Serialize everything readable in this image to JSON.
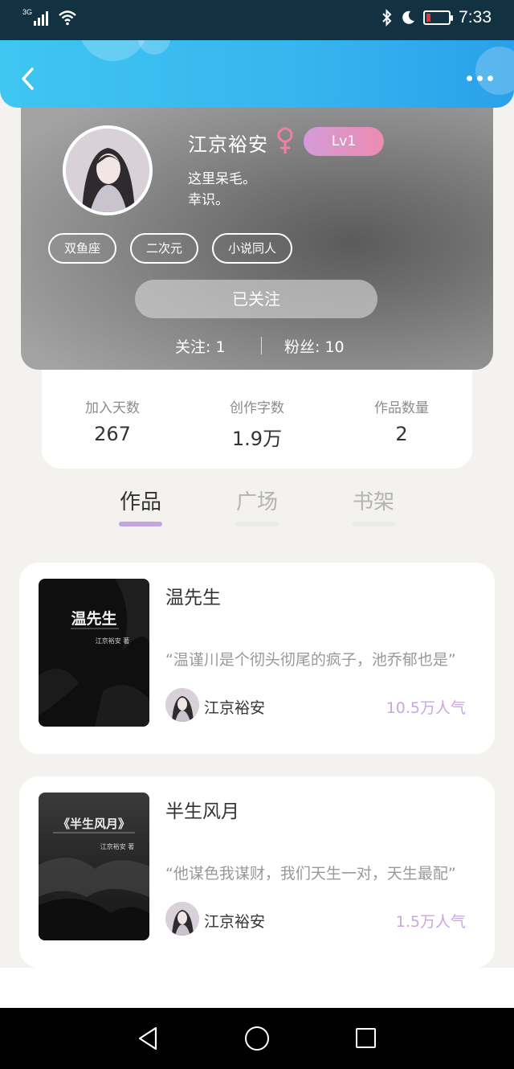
{
  "status_bar": {
    "network": "3G",
    "time": "7:33"
  },
  "header": {
    "back_icon": "chevron-left-icon",
    "more_icon": "more-dots-icon",
    "color_start": "#3fc6f1",
    "color_end": "#2aa0ea"
  },
  "profile": {
    "username": "江京裕安",
    "gender_icon": "female-icon",
    "level": "Lv1",
    "bio_line1": "这里呆毛。",
    "bio_line2": "幸识。",
    "tags": [
      "双鱼座",
      "二次元",
      "小说同人"
    ],
    "follow_button": "已关注",
    "following_label": "关注:",
    "following_count": "1",
    "fans_label": "粉丝:",
    "fans_count": "10"
  },
  "stats": [
    {
      "label": "加入天数",
      "value": "267"
    },
    {
      "label": "创作字数",
      "value": "1.9万"
    },
    {
      "label": "作品数量",
      "value": "2"
    }
  ],
  "tabs": [
    {
      "label": "作品",
      "active": true
    },
    {
      "label": "广场",
      "active": false
    },
    {
      "label": "书架",
      "active": false
    }
  ],
  "books": [
    {
      "title": "温先生",
      "cover_title": "温先生",
      "cover_author": "江京裕安 著",
      "description": "“温谨川是个彻头彻尾的疯子，池乔郁也是”",
      "author": "江京裕安",
      "popularity": "10.5万人气"
    },
    {
      "title": "半生风月",
      "cover_title": "《半生风月》",
      "cover_author": "江京裕安 著",
      "description": "“他谋色我谋财，我们天生一对，天生最配”",
      "author": "江京裕安",
      "popularity": "1.5万人气"
    }
  ],
  "colors": {
    "accent": "#c2a6dd",
    "popularity": "#c9a6e0",
    "level_badge": "#ec8bb1"
  }
}
